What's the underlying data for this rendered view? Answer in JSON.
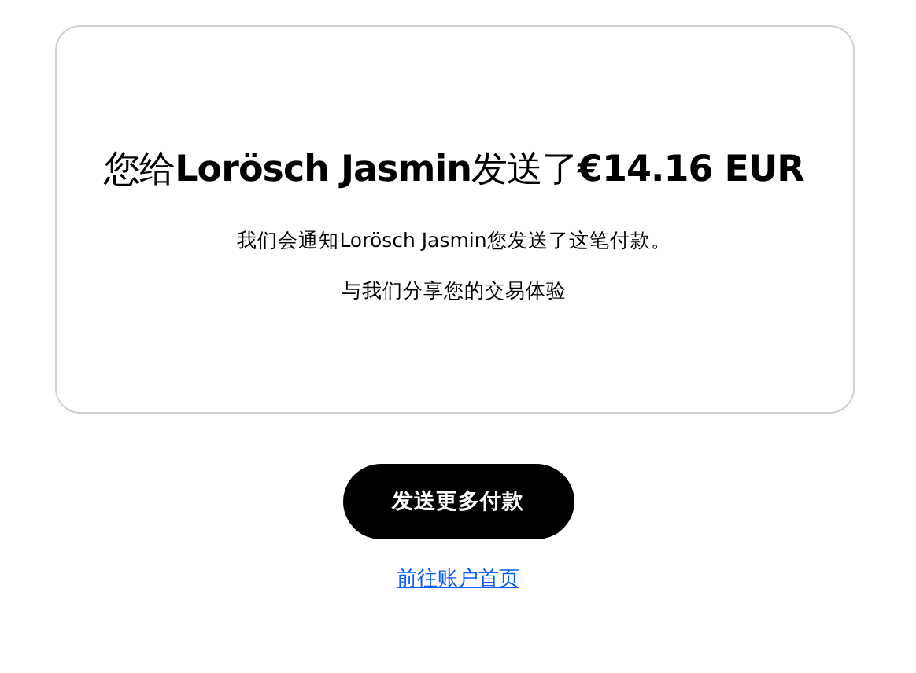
{
  "confirmation": {
    "heading": "您给**Lorösch Jasmin**发送了**€14.16 EUR**",
    "notice": "我们会通知Lorösch Jasmin您发送了这笔付款。",
    "feedback": "与我们分享您的交易体验"
  },
  "actions": {
    "primary_button": "发送更多付款",
    "account_link": "前往账户首页"
  }
}
